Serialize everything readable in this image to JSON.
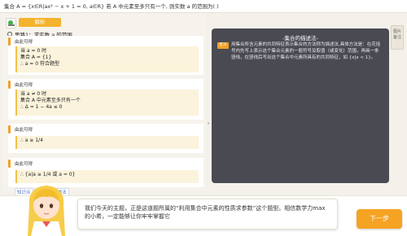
{
  "question": {
    "text": "集合 A = {x∈R|ax² − x + 1 = 0, a∈R} 若 A 中元素至多只有一个, 则实数 a 的范围为( )"
  },
  "left_panel": {
    "tab_label": "解析",
    "step_title": "思路1：求实数 a 的范围",
    "cards": [
      {
        "head": "由此可得",
        "lines": [
          "当 a = 0 时",
          "集合 A = {1}",
          "∴ a = 0 符合题型"
        ]
      },
      {
        "head": "由此可得",
        "lines": [
          "当 a ≠ 0 时",
          "集合 A 中元素至多只有一个",
          "∴ Δ = 1 − 4a ≤ 0"
        ]
      },
      {
        "head": "由此可得",
        "lines": [
          "∴ a ≥ 1/4"
        ]
      },
      {
        "head": "由此可得",
        "lines": [
          "∴ {a|a ≥ 1/4 或 a = 0}"
        ]
      }
    ],
    "links": [
      "知识点",
      "集合的描述法"
    ]
  },
  "right_panel": {
    "title": "-集合的描述法-",
    "tag": "定义",
    "text": "用集合所含元素的共同特征表示集合的方法称为描述法,具体方法是：在花括号内先写上表示这个集合元素的一般符号及取值（或变化）范围，再画一条竖线，在竖线后写出这个集合中元素所具有的共同特征，如 {x|x < 1}。"
  },
  "side_tab": {
    "label": "图片\n备注"
  },
  "footer": {
    "bubble_text": "我们今天的主题，正是这道题所属的“利用集合中元素的性质求参数”这个题型。相信数学力max的小希，一定能够让你牢牢掌握它",
    "next_label": "下一步"
  }
}
